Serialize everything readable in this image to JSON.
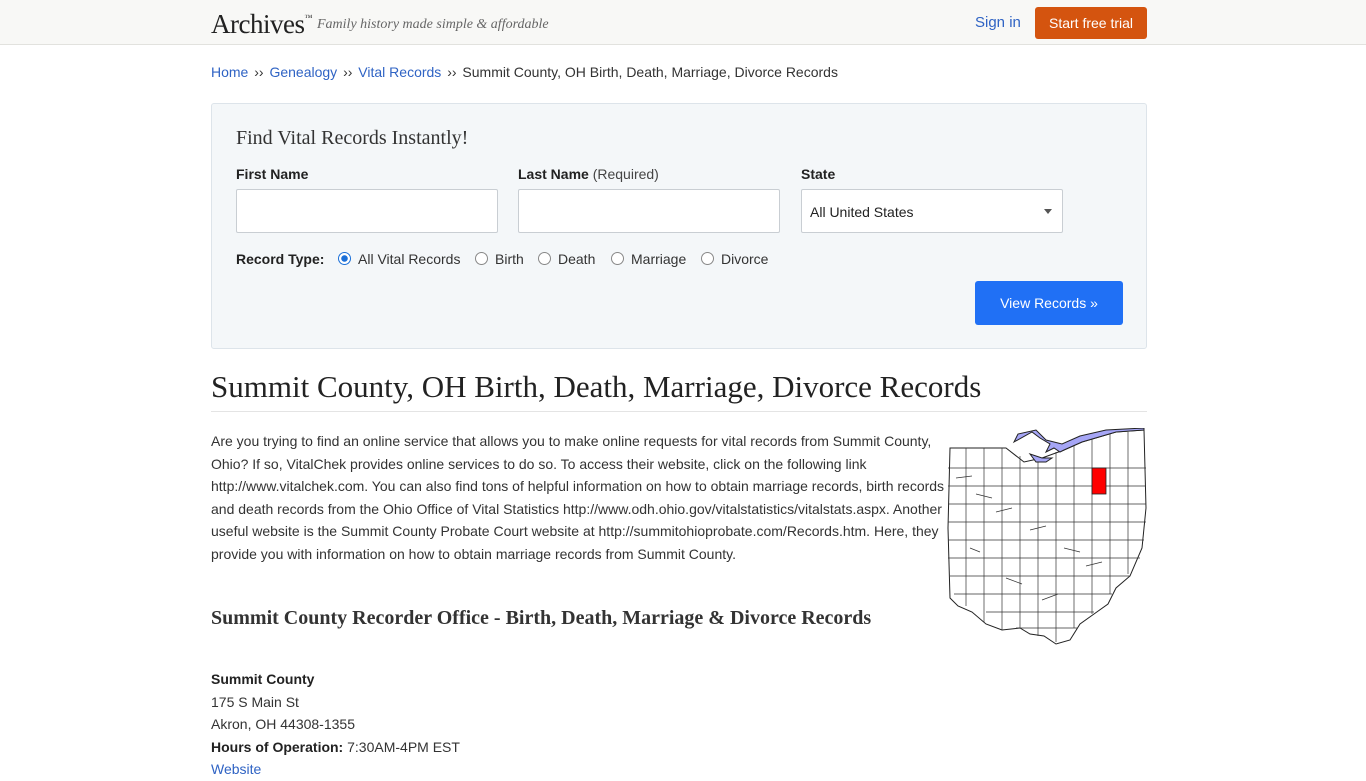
{
  "header": {
    "logo": "Archives",
    "logo_tm": "™",
    "tagline": "Family history made simple & affordable",
    "signin_label": "Sign in",
    "trial_label": "Start free trial"
  },
  "breadcrumb": {
    "items": [
      "Home",
      "Genealogy",
      "Vital Records"
    ],
    "separator": "››",
    "current": "Summit County, OH Birth, Death, Marriage, Divorce Records"
  },
  "search": {
    "title": "Find Vital Records Instantly!",
    "first_name_label": "First Name",
    "last_name_label": "Last Name",
    "last_name_required": "(Required)",
    "state_label": "State",
    "first_name_value": "",
    "last_name_value": "",
    "state_selected": "All United States",
    "record_type_label": "Record Type:",
    "record_types": [
      "All Vital Records",
      "Birth",
      "Death",
      "Marriage",
      "Divorce"
    ],
    "record_type_selected": "All Vital Records",
    "submit_label": "View Records »"
  },
  "page": {
    "title": "Summit County, OH Birth, Death, Marriage, Divorce Records",
    "intro": "Are you trying to find an online service that allows you to make online requests for vital records from Summit County, Ohio? If so, VitalChek provides online services to do so. To access their website, click on the following link http://www.vitalchek.com. You can also find tons of helpful information on how to obtain marriage records, birth records and death records from the Ohio Office of Vital Statistics http://www.odh.ohio.gov/vitalstatistics/vitalstats.aspx. Another useful website is the Summit County Probate Court website at http://summitohioprobate.com/Records.htm. Here, they provide you with information on how to obtain marriage records from Summit County.",
    "section_title": "Summit County Recorder Office - Birth, Death, Marriage & Divorce Records"
  },
  "office": {
    "name": "Summit County",
    "address1": "175 S Main St",
    "address2": "Akron, OH 44308-1355",
    "hours_label": "Hours of Operation:",
    "hours_value": "7:30AM-4PM EST",
    "website_label": "Website"
  },
  "map": {
    "highlight_color": "#ff0000",
    "lake_color": "#a6a6f6"
  },
  "colors": {
    "link": "#2f63c4",
    "trial_button": "#d4540f",
    "view_button": "#2070f5"
  }
}
